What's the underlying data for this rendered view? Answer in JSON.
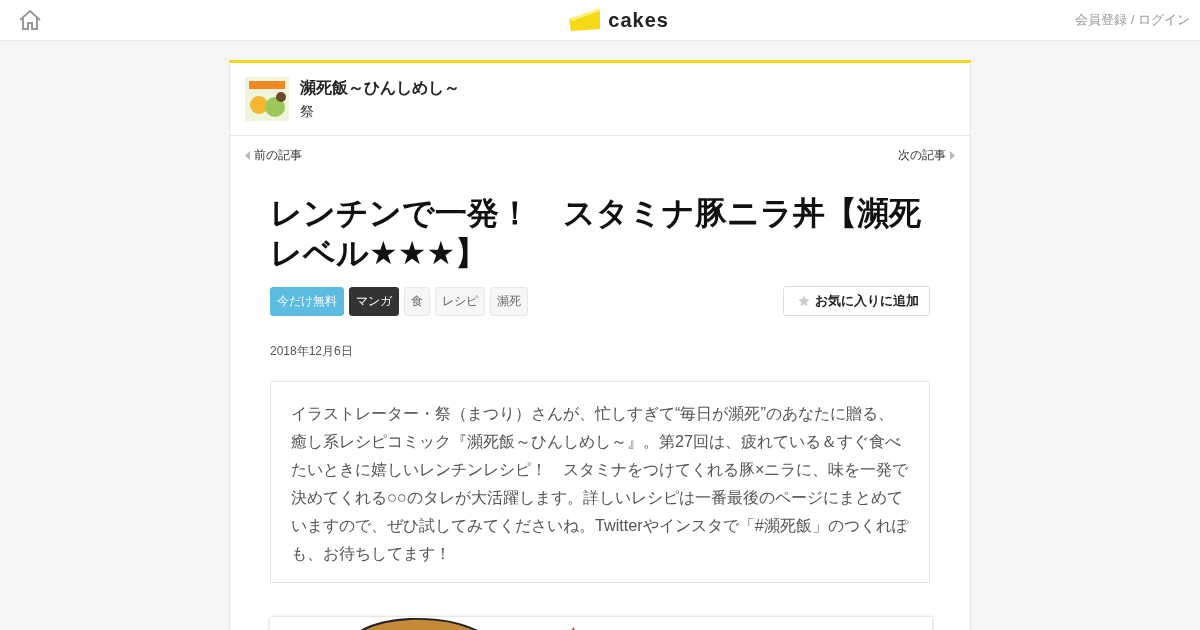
{
  "header": {
    "logo_text": "cakes",
    "account_link": "会員登録 / ログイン"
  },
  "series": {
    "title": "瀕死飯～ひんしめし～",
    "author": "祭"
  },
  "nav": {
    "prev": "前の記事",
    "next": "次の記事"
  },
  "article": {
    "title": "レンチンで一発！　スタミナ豚ニラ丼【瀕死レベル★★★】",
    "tags": [
      {
        "label": "今だけ無料",
        "kind": "free"
      },
      {
        "label": "マンガ",
        "kind": "category"
      },
      {
        "label": "食",
        "kind": "plain"
      },
      {
        "label": "レシピ",
        "kind": "plain"
      },
      {
        "label": "瀕死",
        "kind": "plain"
      }
    ],
    "favorite_button": "お気に入りに追加",
    "date": "2018年12月6日",
    "lead": "イラストレーター・祭（まつり）さんが、忙しすぎて“毎日が瀕死”のあなたに贈る、癒し系レシピコミック『瀕死飯～ひんしめし～』。第27回は、疲れている＆すぐ食べたいときに嬉しいレンチンレシピ！　スタミナをつけてくれる豚×ニラに、味を一発で決めてくれる○○のタレが大活躍します。詳しいレシピは一番最後のページにまとめていますので、ぜひ試してみてくださいね。Twitterやインスタで「#瀕死飯」のつくれぽも、お待ちしてます！"
  }
}
